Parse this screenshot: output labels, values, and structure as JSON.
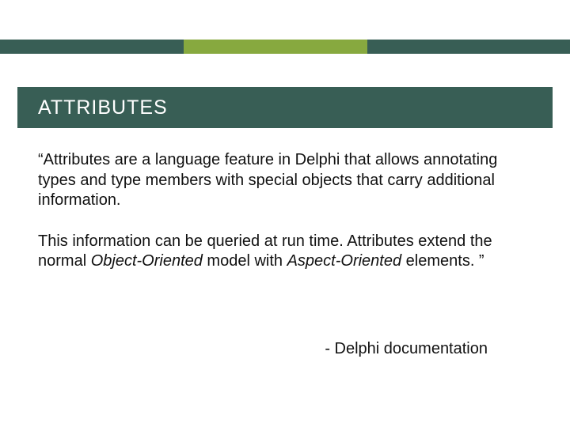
{
  "colors": {
    "dark_green": "#385e55",
    "olive": "#87a93f"
  },
  "title": "ATTRIBUTES",
  "paragraphs": {
    "p1": "“Attributes are a language feature in Delphi that allows annotating types and type members with special objects that carry additional information.",
    "p2_pre": "This information can be queried at run time. Attributes extend the normal ",
    "p2_i1": "Object-Oriented",
    "p2_mid": " model with ",
    "p2_i2": "Aspect-Oriented",
    "p2_post": " elements. ”"
  },
  "attribution": "- Delphi documentation"
}
